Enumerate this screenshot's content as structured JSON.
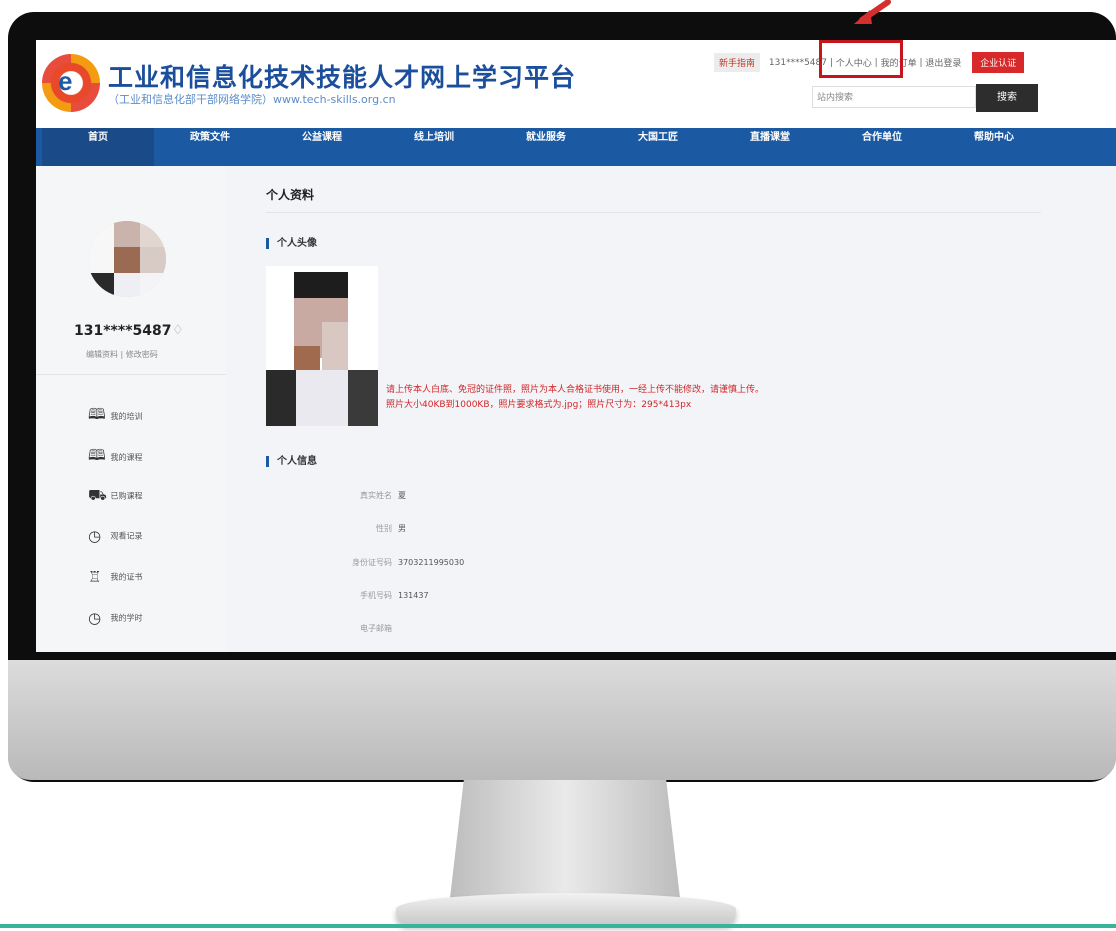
{
  "site": {
    "title": "工业和信息化技术技能人才网上学习平台",
    "subtitle": "（工业和信息化部干部网络学院）www.tech-skills.org.cn"
  },
  "topbar": {
    "new_user": "新手指南",
    "phone": "131****5487",
    "personal_center": "个人中心",
    "my_orders": "我的订单",
    "logout": "退出登录",
    "corp_auth": "企业认证"
  },
  "search": {
    "placeholder": "站内搜索",
    "button": "搜索"
  },
  "nav": {
    "items": [
      "首页",
      "政策文件",
      "公益课程",
      "线上培训",
      "就业服务",
      "大国工匠",
      "直播课堂",
      "合作单位",
      "帮助中心"
    ]
  },
  "sidebar": {
    "username": "131****5487",
    "edit_profile": "编辑资料",
    "change_password": "修改密码",
    "divider": "|",
    "menu": [
      {
        "label": "我的培训",
        "icon": "book-icon"
      },
      {
        "label": "我的课程",
        "icon": "book-icon"
      },
      {
        "label": "已购课程",
        "icon": "cart-icon"
      },
      {
        "label": "观看记录",
        "icon": "clock-icon"
      },
      {
        "label": "我的证书",
        "icon": "trophy-icon"
      },
      {
        "label": "我的学时",
        "icon": "clock-icon"
      }
    ]
  },
  "main": {
    "page_title": "个人资料",
    "avatar_section": "个人头像",
    "avatar_note_line1": "请上传本人白底、免冠的证件照，照片为本人合格证书使用，一经上传不能修改，请谨慎上传。",
    "avatar_note_line2": "照片大小40KB到1000KB，照片要求格式为.jpg；照片尺寸为：295*413px",
    "info_section": "个人信息",
    "fields": [
      {
        "label": "真实姓名",
        "value": "夏"
      },
      {
        "label": "性别",
        "value": "男"
      },
      {
        "label": "身份证号码",
        "value": "3703211995030"
      },
      {
        "label": "手机号码",
        "value": "131437"
      },
      {
        "label": "电子邮箱",
        "value": ""
      }
    ]
  },
  "colors": {
    "brand_blue": "#1b5aa3",
    "accent_red": "#d8282a",
    "note_red": "#d0262a"
  }
}
